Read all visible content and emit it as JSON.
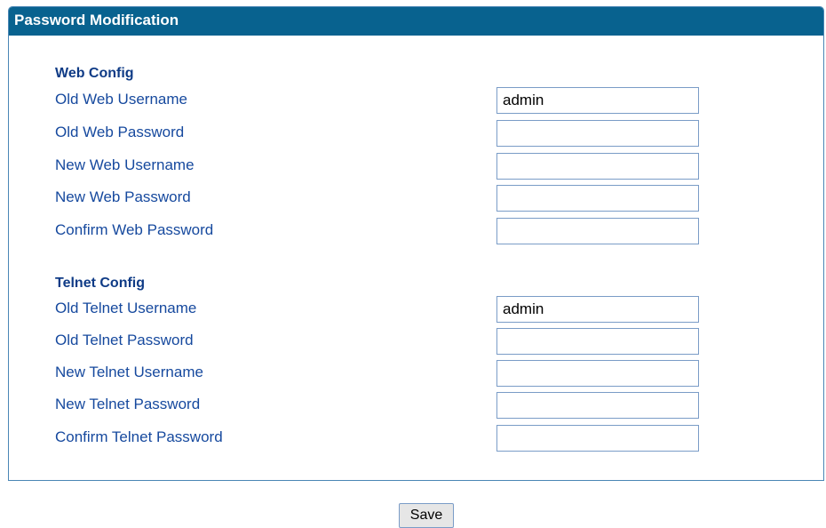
{
  "panel": {
    "title": "Password Modification"
  },
  "web_config": {
    "title": "Web Config",
    "fields": [
      {
        "label": "Old Web Username",
        "value": ""
      },
      {
        "label": "Old Web Password",
        "value": ""
      },
      {
        "label": "New Web Username",
        "value": ""
      },
      {
        "label": "New Web Password",
        "value": ""
      },
      {
        "label": "Confirm Web Password",
        "value": ""
      }
    ]
  },
  "telnet_config": {
    "title": "Telnet Config",
    "fields": [
      {
        "label": "Old Telnet Username",
        "value": ""
      },
      {
        "label": "Old Telnet Password",
        "value": ""
      },
      {
        "label": "New Telnet Username",
        "value": ""
      },
      {
        "label": "New Telnet Password",
        "value": ""
      },
      {
        "label": "Confirm Telnet Password",
        "value": ""
      }
    ]
  },
  "values": {
    "old_web_username": "admin",
    "old_telnet_username": "admin"
  },
  "actions": {
    "save_label": "Save"
  },
  "colors": {
    "header_bg": "#08628f",
    "label_text": "#16499e",
    "section_title": "#0f3b86",
    "border": "#4a86b5"
  }
}
